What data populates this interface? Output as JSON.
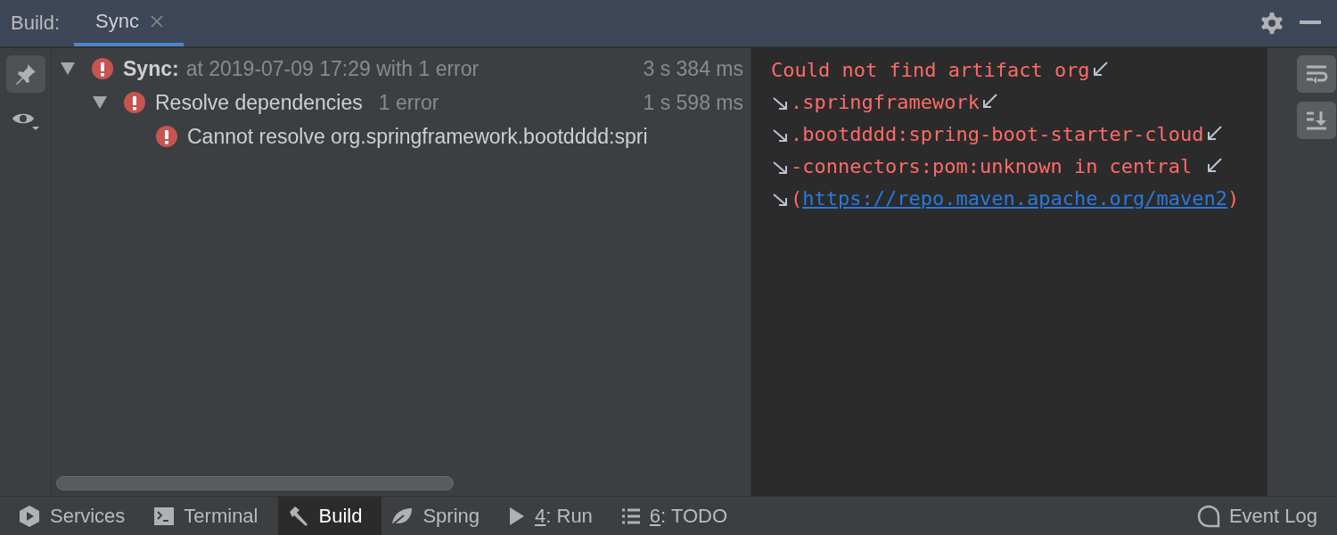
{
  "header": {
    "title": "Build:",
    "tabs": [
      {
        "label": "Sync",
        "selected": true
      }
    ]
  },
  "tree": [
    {
      "expanded": true,
      "bold_label": "Sync:",
      "label": "at 2019-07-09 17:29 with 1 error",
      "time": "3 s 384 ms",
      "children": [
        {
          "expanded": true,
          "label": "Resolve dependencies",
          "detail": "1 error",
          "time": "1 s 598 ms",
          "children": [
            {
              "label": "Cannot resolve org.springframework.bootdddd:spri"
            }
          ]
        }
      ]
    }
  ],
  "left_toolbar": [
    {
      "selected": true
    },
    {
      "selected": false
    }
  ],
  "console": [
    {
      "wrap_in": false,
      "wrap_out": true,
      "segments": [
        {
          "kind": "text",
          "text": "Could not find artifact org"
        }
      ]
    },
    {
      "wrap_in": true,
      "wrap_out": true,
      "segments": [
        {
          "kind": "text",
          "text": ".springframework"
        }
      ]
    },
    {
      "wrap_in": true,
      "wrap_out": true,
      "segments": [
        {
          "kind": "text",
          "text": ".bootdddd:spring-boot-starter-cloud"
        }
      ]
    },
    {
      "wrap_in": true,
      "wrap_out": true,
      "segments": [
        {
          "kind": "text",
          "text": "-connectors:pom:unknown in central "
        }
      ]
    },
    {
      "wrap_in": true,
      "wrap_out": false,
      "segments": [
        {
          "kind": "text",
          "text": "("
        },
        {
          "kind": "link",
          "text": "https://repo.maven.apache.org/maven2"
        },
        {
          "kind": "text",
          "text": ")"
        }
      ]
    }
  ],
  "right_toolbar": [
    {
      "selected": true
    },
    {
      "selected": true
    }
  ],
  "bottom_tabs": [
    {
      "label": "Services",
      "selected": false
    },
    {
      "label": "Terminal",
      "selected": false
    },
    {
      "label": "Build",
      "selected": true
    },
    {
      "label": "Spring",
      "selected": false
    },
    {
      "mnemonic": "4",
      "label": ": Run",
      "selected": false
    },
    {
      "mnemonic": "6",
      "label": ": TODO",
      "selected": false
    }
  ],
  "event_log": {
    "label": "Event Log"
  }
}
